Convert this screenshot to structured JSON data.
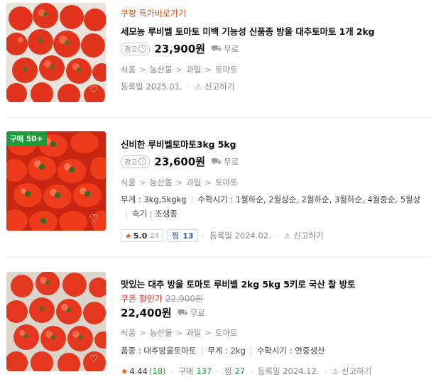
{
  "items": [
    {
      "promo": "쿠팡 특가바로가기",
      "title": "세모농 루비벨 토마토 미백 기능성 신품종 방울 대추토마토 1개 2kg",
      "ad_label": "광고",
      "price": "23,900원",
      "shipping": "무료",
      "categories": [
        "식품",
        "농산물",
        "과일",
        "토마토"
      ],
      "reg_date": "등록일 2025.01.",
      "report": "신고하기"
    },
    {
      "badge": "구매 50+",
      "title": "신비한 루비벨토마토3kg 5kg",
      "ad_label": "광고",
      "price": "23,600원",
      "shipping": "무료",
      "categories": [
        "식품",
        "농산물",
        "과일",
        "토마토"
      ],
      "specs_line1": [
        "무게 : 3kg,5kgkg",
        "수확시기 : 1월하순, 2월상순, 2월하순, 3월하순, 4월중순, 5월상"
      ],
      "specs_line2": "숙기 : 조생종",
      "rating": "5.0",
      "review_count": "24",
      "zzim_label": "찜",
      "zzim_count": "13",
      "reg_date": "등록일 2024.02.",
      "report": "신고하기"
    },
    {
      "title": "맛있는 대추 방울 토마토 루비벨 2kg 5kg 5키로 국산 찰 방토",
      "coupon_label": "쿠폰 할인가",
      "original_price": "22,900원",
      "price": "22,400원",
      "shipping": "무료",
      "categories": [
        "식품",
        "농산물",
        "과일",
        "토마토"
      ],
      "specs": [
        "품종 : 대추방울토마토",
        "무게 : 2kg",
        "수확시기 : 연중생산"
      ],
      "rating": "4.44",
      "review_count": "(18)",
      "purchase_label": "구매",
      "purchase_count": "137",
      "zzim_label": "찜",
      "zzim_count": "27",
      "reg_date": "등록일 2024.12.",
      "report": "신고하기"
    }
  ],
  "colors": {
    "promo": "#e8541c",
    "badge": "#1e9b3b",
    "coupon": "#d7362b",
    "star": "#e8541c"
  }
}
